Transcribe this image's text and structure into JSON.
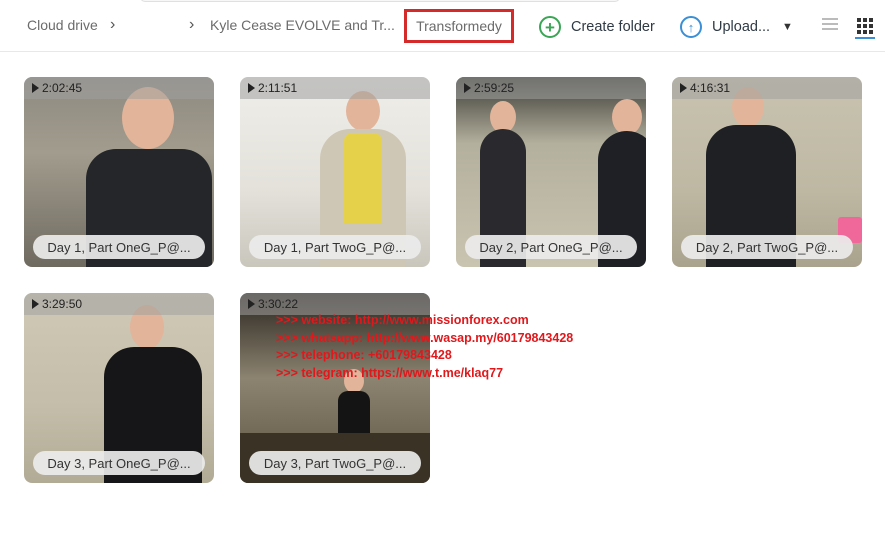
{
  "breadcrumb": {
    "root": "Cloud drive",
    "parent": "Kyle Cease EVOLVE and Tr...",
    "current": "Transformedy"
  },
  "toolbar": {
    "create_folder": "Create folder",
    "upload": "Upload..."
  },
  "tiles": [
    {
      "duration": "2:02:45",
      "name": "Day 1, Part OneG_P@..."
    },
    {
      "duration": "2:11:51",
      "name": "Day 1, Part TwoG_P@..."
    },
    {
      "duration": "2:59:25",
      "name": "Day 2, Part OneG_P@..."
    },
    {
      "duration": "4:16:31",
      "name": "Day 2, Part TwoG_P@..."
    },
    {
      "duration": "3:29:50",
      "name": "Day 3, Part OneG_P@..."
    },
    {
      "duration": "3:30:22",
      "name": "Day 3, Part TwoG_P@..."
    }
  ],
  "watermark": [
    ">>> website: http://www.missionforex.com",
    ">>> whatsapp: http://www.wasap.my/60179843428",
    ">>> telephone: +60179843428",
    ">>> telegram: https://www.t.me/klaq77"
  ],
  "colors": {
    "highlight_box": "#d42a2a",
    "create_icon": "#3aa655",
    "upload_icon": "#3a8fd6",
    "watermark": "#e0181c"
  }
}
